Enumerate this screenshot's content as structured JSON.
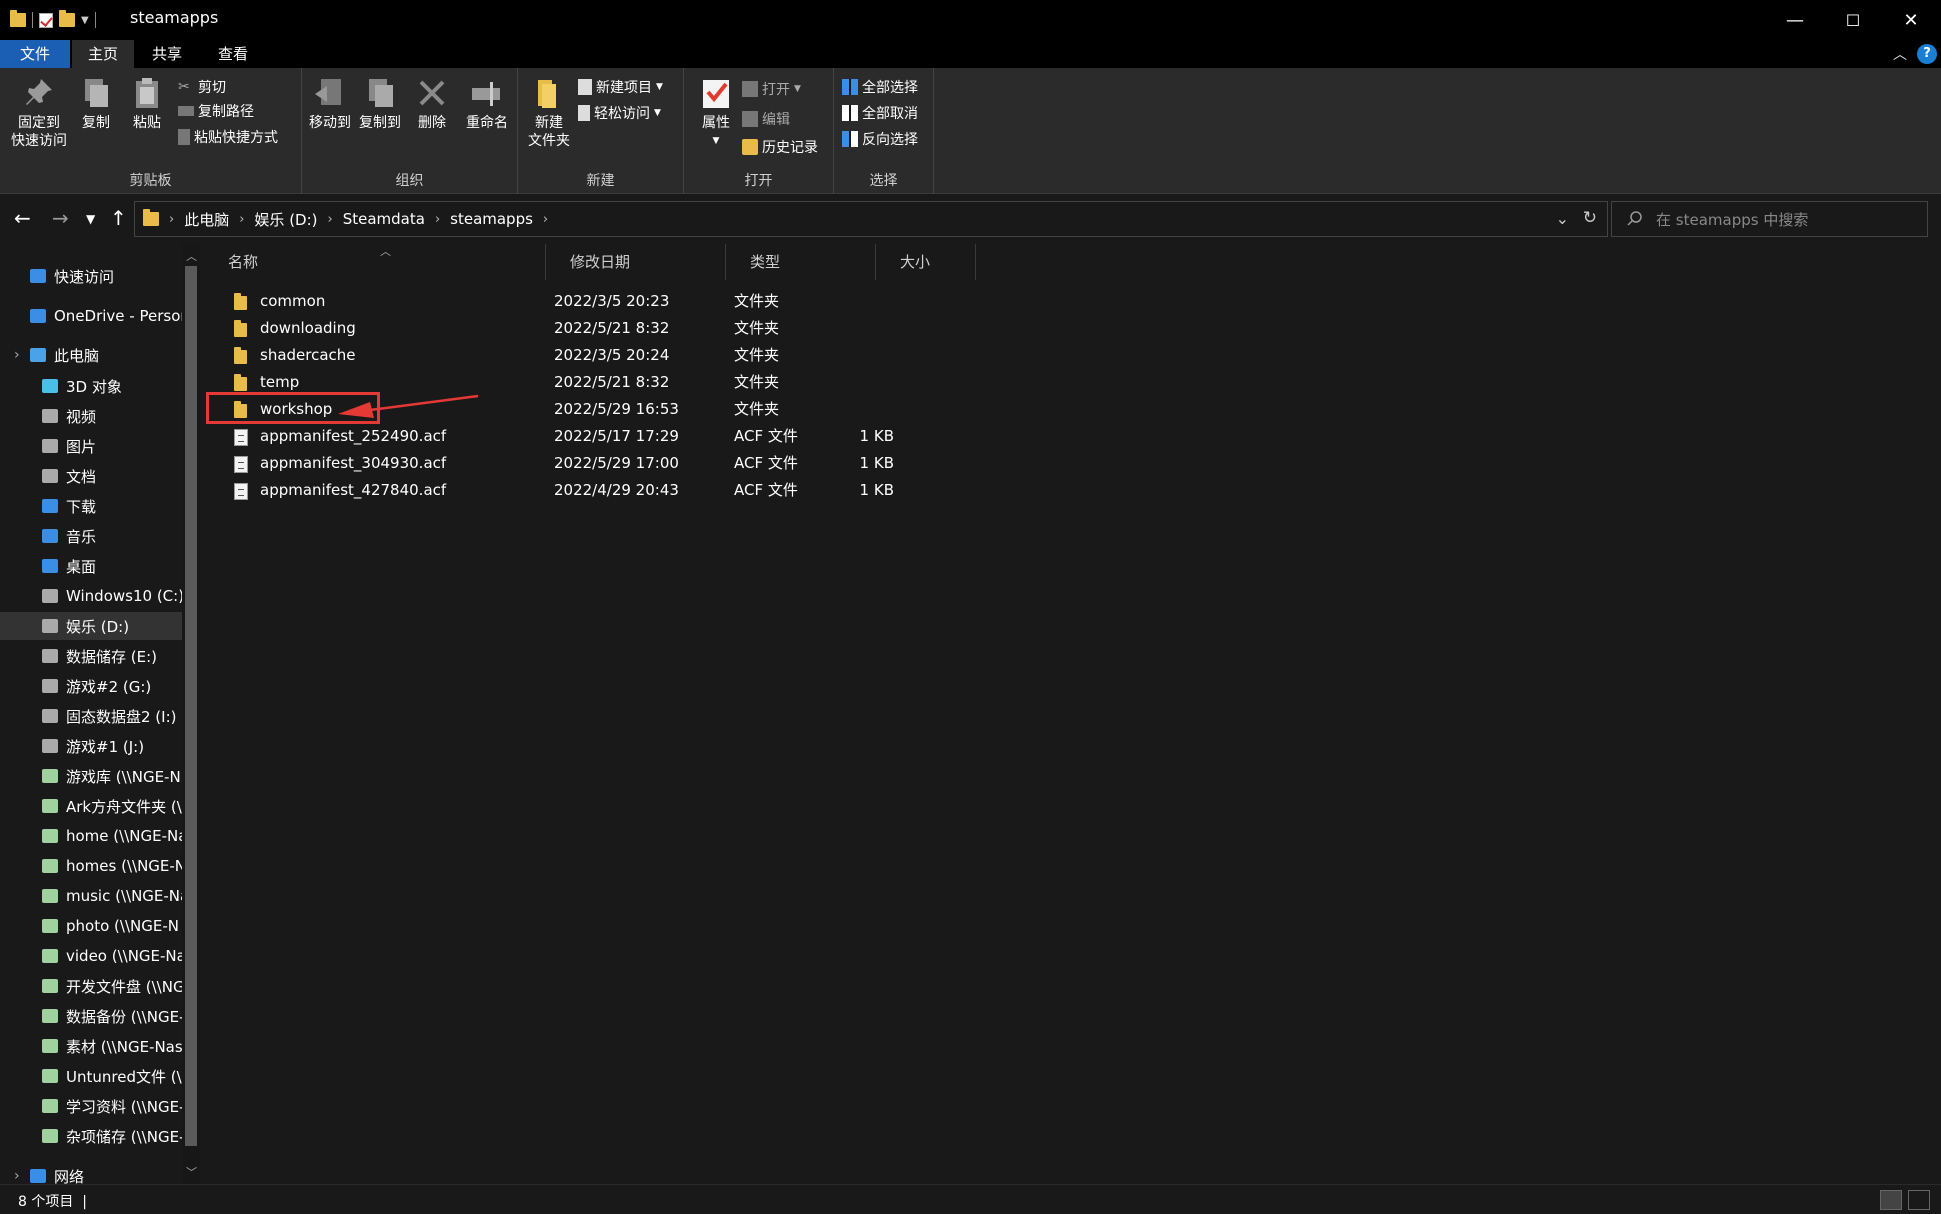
{
  "window": {
    "title": "steamapps",
    "controls": {
      "minimize": "—",
      "maximize": "☐",
      "close": "✕"
    }
  },
  "ribbon_tabs": [
    "文件",
    "主页",
    "共享",
    "查看"
  ],
  "ribbon": {
    "clipboard": {
      "label": "剪贴板",
      "pin": [
        "固定到",
        "快速访问"
      ],
      "copy": "复制",
      "paste": "粘贴",
      "cut": "剪切",
      "copy_path": "复制路径",
      "paste_shortcut": "粘贴快捷方式"
    },
    "organize": {
      "label": "组织",
      "move_to": "移动到",
      "copy_to": "复制到",
      "delete": "删除",
      "rename": "重命名"
    },
    "new": {
      "label": "新建",
      "new_folder": [
        "新建",
        "文件夹"
      ],
      "new_item": "新建项目",
      "easy_access": "轻松访问"
    },
    "open": {
      "label": "打开",
      "properties": "属性",
      "open": "打开",
      "edit": "编辑",
      "history": "历史记录"
    },
    "select": {
      "label": "选择",
      "select_all": "全部选择",
      "select_none": "全部取消",
      "invert": "反向选择"
    }
  },
  "address": {
    "breadcrumbs": [
      "此电脑",
      "娱乐 (D:)",
      "Steamdata",
      "steamapps"
    ],
    "search_placeholder": "在 steamapps 中搜索"
  },
  "nav_pane": [
    {
      "label": "快速访问",
      "icon": "star-icon",
      "color": "#3a8ee6"
    },
    {
      "label": "OneDrive - Personal",
      "icon": "cloud-icon",
      "color": "#3a8ee6"
    },
    {
      "label": "此电脑",
      "icon": "computer-icon",
      "color": "#4aa3e8"
    },
    {
      "label": "3D 对象",
      "icon": "3d-objects-icon",
      "color": "#4ac0e8"
    },
    {
      "label": "视频",
      "icon": "video-icon",
      "color": "#aaaaaa"
    },
    {
      "label": "图片",
      "icon": "pictures-icon",
      "color": "#aaaaaa"
    },
    {
      "label": "文档",
      "icon": "documents-icon",
      "color": "#aaaaaa"
    },
    {
      "label": "下载",
      "icon": "download-icon",
      "color": "#3a8ee6"
    },
    {
      "label": "音乐",
      "icon": "music-icon",
      "color": "#3a8ee6"
    },
    {
      "label": "桌面",
      "icon": "desktop-icon",
      "color": "#3a8ee6"
    },
    {
      "label": "Windows10 (C:)",
      "icon": "drive-icon",
      "color": "#aaaaaa"
    },
    {
      "label": "娱乐 (D:)",
      "icon": "drive-icon",
      "color": "#aaaaaa",
      "selected": true
    },
    {
      "label": "数据储存 (E:)",
      "icon": "drive-icon",
      "color": "#aaaaaa"
    },
    {
      "label": "游戏#2 (G:)",
      "icon": "drive-icon",
      "color": "#aaaaaa"
    },
    {
      "label": "固态数据盘2 (I:)",
      "icon": "drive-icon",
      "color": "#aaaaaa"
    },
    {
      "label": "游戏#1 (J:)",
      "icon": "drive-icon",
      "color": "#aaaaaa"
    },
    {
      "label": "游戏库 (\\\\NGE-N",
      "icon": "network-drive-icon",
      "color": "#9fd29f"
    },
    {
      "label": "Ark方舟文件夹 (\\",
      "icon": "network-drive-icon",
      "color": "#9fd29f"
    },
    {
      "label": "home (\\\\NGE-Na",
      "icon": "network-drive-icon",
      "color": "#9fd29f"
    },
    {
      "label": "homes (\\\\NGE-N",
      "icon": "network-drive-icon",
      "color": "#9fd29f"
    },
    {
      "label": "music (\\\\NGE-Na",
      "icon": "network-drive-icon",
      "color": "#9fd29f"
    },
    {
      "label": "photo (\\\\NGE-N",
      "icon": "network-drive-icon",
      "color": "#9fd29f"
    },
    {
      "label": "video (\\\\NGE-Na",
      "icon": "network-drive-icon",
      "color": "#9fd29f"
    },
    {
      "label": "开发文件盘 (\\\\NG",
      "icon": "network-drive-icon",
      "color": "#9fd29f"
    },
    {
      "label": "数据备份 (\\\\NGE-",
      "icon": "network-drive-icon",
      "color": "#9fd29f"
    },
    {
      "label": "素材 (\\\\NGE-Nas",
      "icon": "network-drive-icon",
      "color": "#9fd29f"
    },
    {
      "label": "Untunred文件 (\\",
      "icon": "network-drive-icon",
      "color": "#9fd29f"
    },
    {
      "label": "学习资料 (\\\\NGE-",
      "icon": "network-drive-icon",
      "color": "#9fd29f"
    },
    {
      "label": "杂项储存 (\\\\NGE-",
      "icon": "network-drive-icon",
      "color": "#9fd29f"
    },
    {
      "label": "网络",
      "icon": "network-icon",
      "color": "#3a8ee6"
    }
  ],
  "columns": [
    "名称",
    "修改日期",
    "类型",
    "大小"
  ],
  "files": [
    {
      "name": "common",
      "date": "2022/3/5 20:23",
      "type": "文件夹",
      "size": "",
      "kind": "folder"
    },
    {
      "name": "downloading",
      "date": "2022/5/21 8:32",
      "type": "文件夹",
      "size": "",
      "kind": "folder"
    },
    {
      "name": "shadercache",
      "date": "2022/3/5 20:24",
      "type": "文件夹",
      "size": "",
      "kind": "folder"
    },
    {
      "name": "temp",
      "date": "2022/5/21 8:32",
      "type": "文件夹",
      "size": "",
      "kind": "folder"
    },
    {
      "name": "workshop",
      "date": "2022/5/29 16:53",
      "type": "文件夹",
      "size": "",
      "kind": "folder"
    },
    {
      "name": "appmanifest_252490.acf",
      "date": "2022/5/17 17:29",
      "type": "ACF 文件",
      "size": "1 KB",
      "kind": "file"
    },
    {
      "name": "appmanifest_304930.acf",
      "date": "2022/5/29 17:00",
      "type": "ACF 文件",
      "size": "1 KB",
      "kind": "file"
    },
    {
      "name": "appmanifest_427840.acf",
      "date": "2022/4/29 20:43",
      "type": "ACF 文件",
      "size": "1 KB",
      "kind": "file"
    }
  ],
  "status": {
    "count": "8 个项目"
  },
  "colors": {
    "accent": "#1a5fb4",
    "annotation": "#e53935",
    "folder": "#e9bb48"
  }
}
